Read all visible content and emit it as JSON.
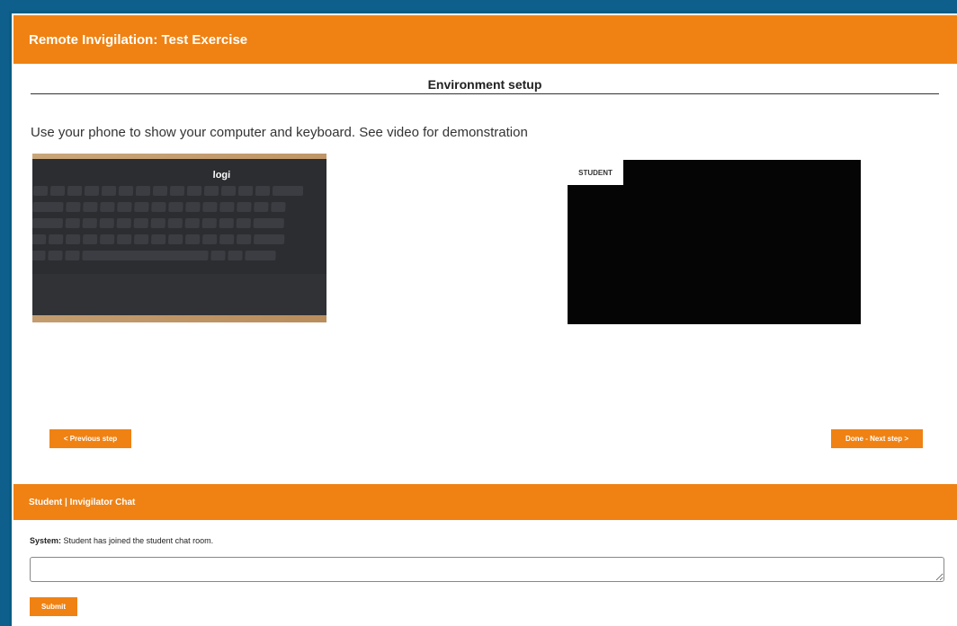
{
  "header": {
    "title": "Remote Invigilation: Test Exercise"
  },
  "section": {
    "title": "Environment setup"
  },
  "instruction": "Use your phone to show your computer and keyboard. See video for demonstration",
  "demo_image": {
    "logo_text": "logi"
  },
  "video": {
    "label": "STUDENT"
  },
  "navigation": {
    "previous_label": "< Previous step",
    "next_label": "Done - Next step >"
  },
  "chat": {
    "title": "Student | Invigilator Chat",
    "message_sender": "System:",
    "message_text": " Student has joined the student chat room.",
    "input_value": "",
    "submit_label": "Submit"
  },
  "colors": {
    "accent": "#ef8213",
    "border": "#0f5f8c",
    "video_bg": "#050505"
  }
}
